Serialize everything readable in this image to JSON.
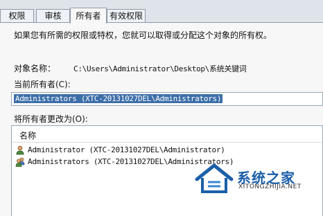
{
  "tabs": [
    {
      "label": "权限"
    },
    {
      "label": "审核"
    },
    {
      "label": "所有者"
    },
    {
      "label": "有效权限"
    }
  ],
  "description": "如果您有所需的权限或特权，您就可以取得或分配这个对象的所有权。",
  "object_name": {
    "label": "对象名称：",
    "value": "C:\\Users\\Administrator\\Desktop\\系统关键词"
  },
  "current_owner": {
    "label": "当前所有者(C):",
    "value": "Administrators (XTC-20131027DEL\\Administrators)"
  },
  "change_owner": {
    "label": "将所有者更改为(O):",
    "column_header": "名称",
    "items": [
      {
        "name": "Administrator (XTC-20131027DEL\\Administrator)",
        "icon": "user-icon"
      },
      {
        "name": "Administrators (XTC-20131027DEL\\Administrators)",
        "icon": "group-icon"
      }
    ]
  },
  "watermark": {
    "title": "系统之家",
    "url": "XITONGZHIJIA.NET"
  }
}
